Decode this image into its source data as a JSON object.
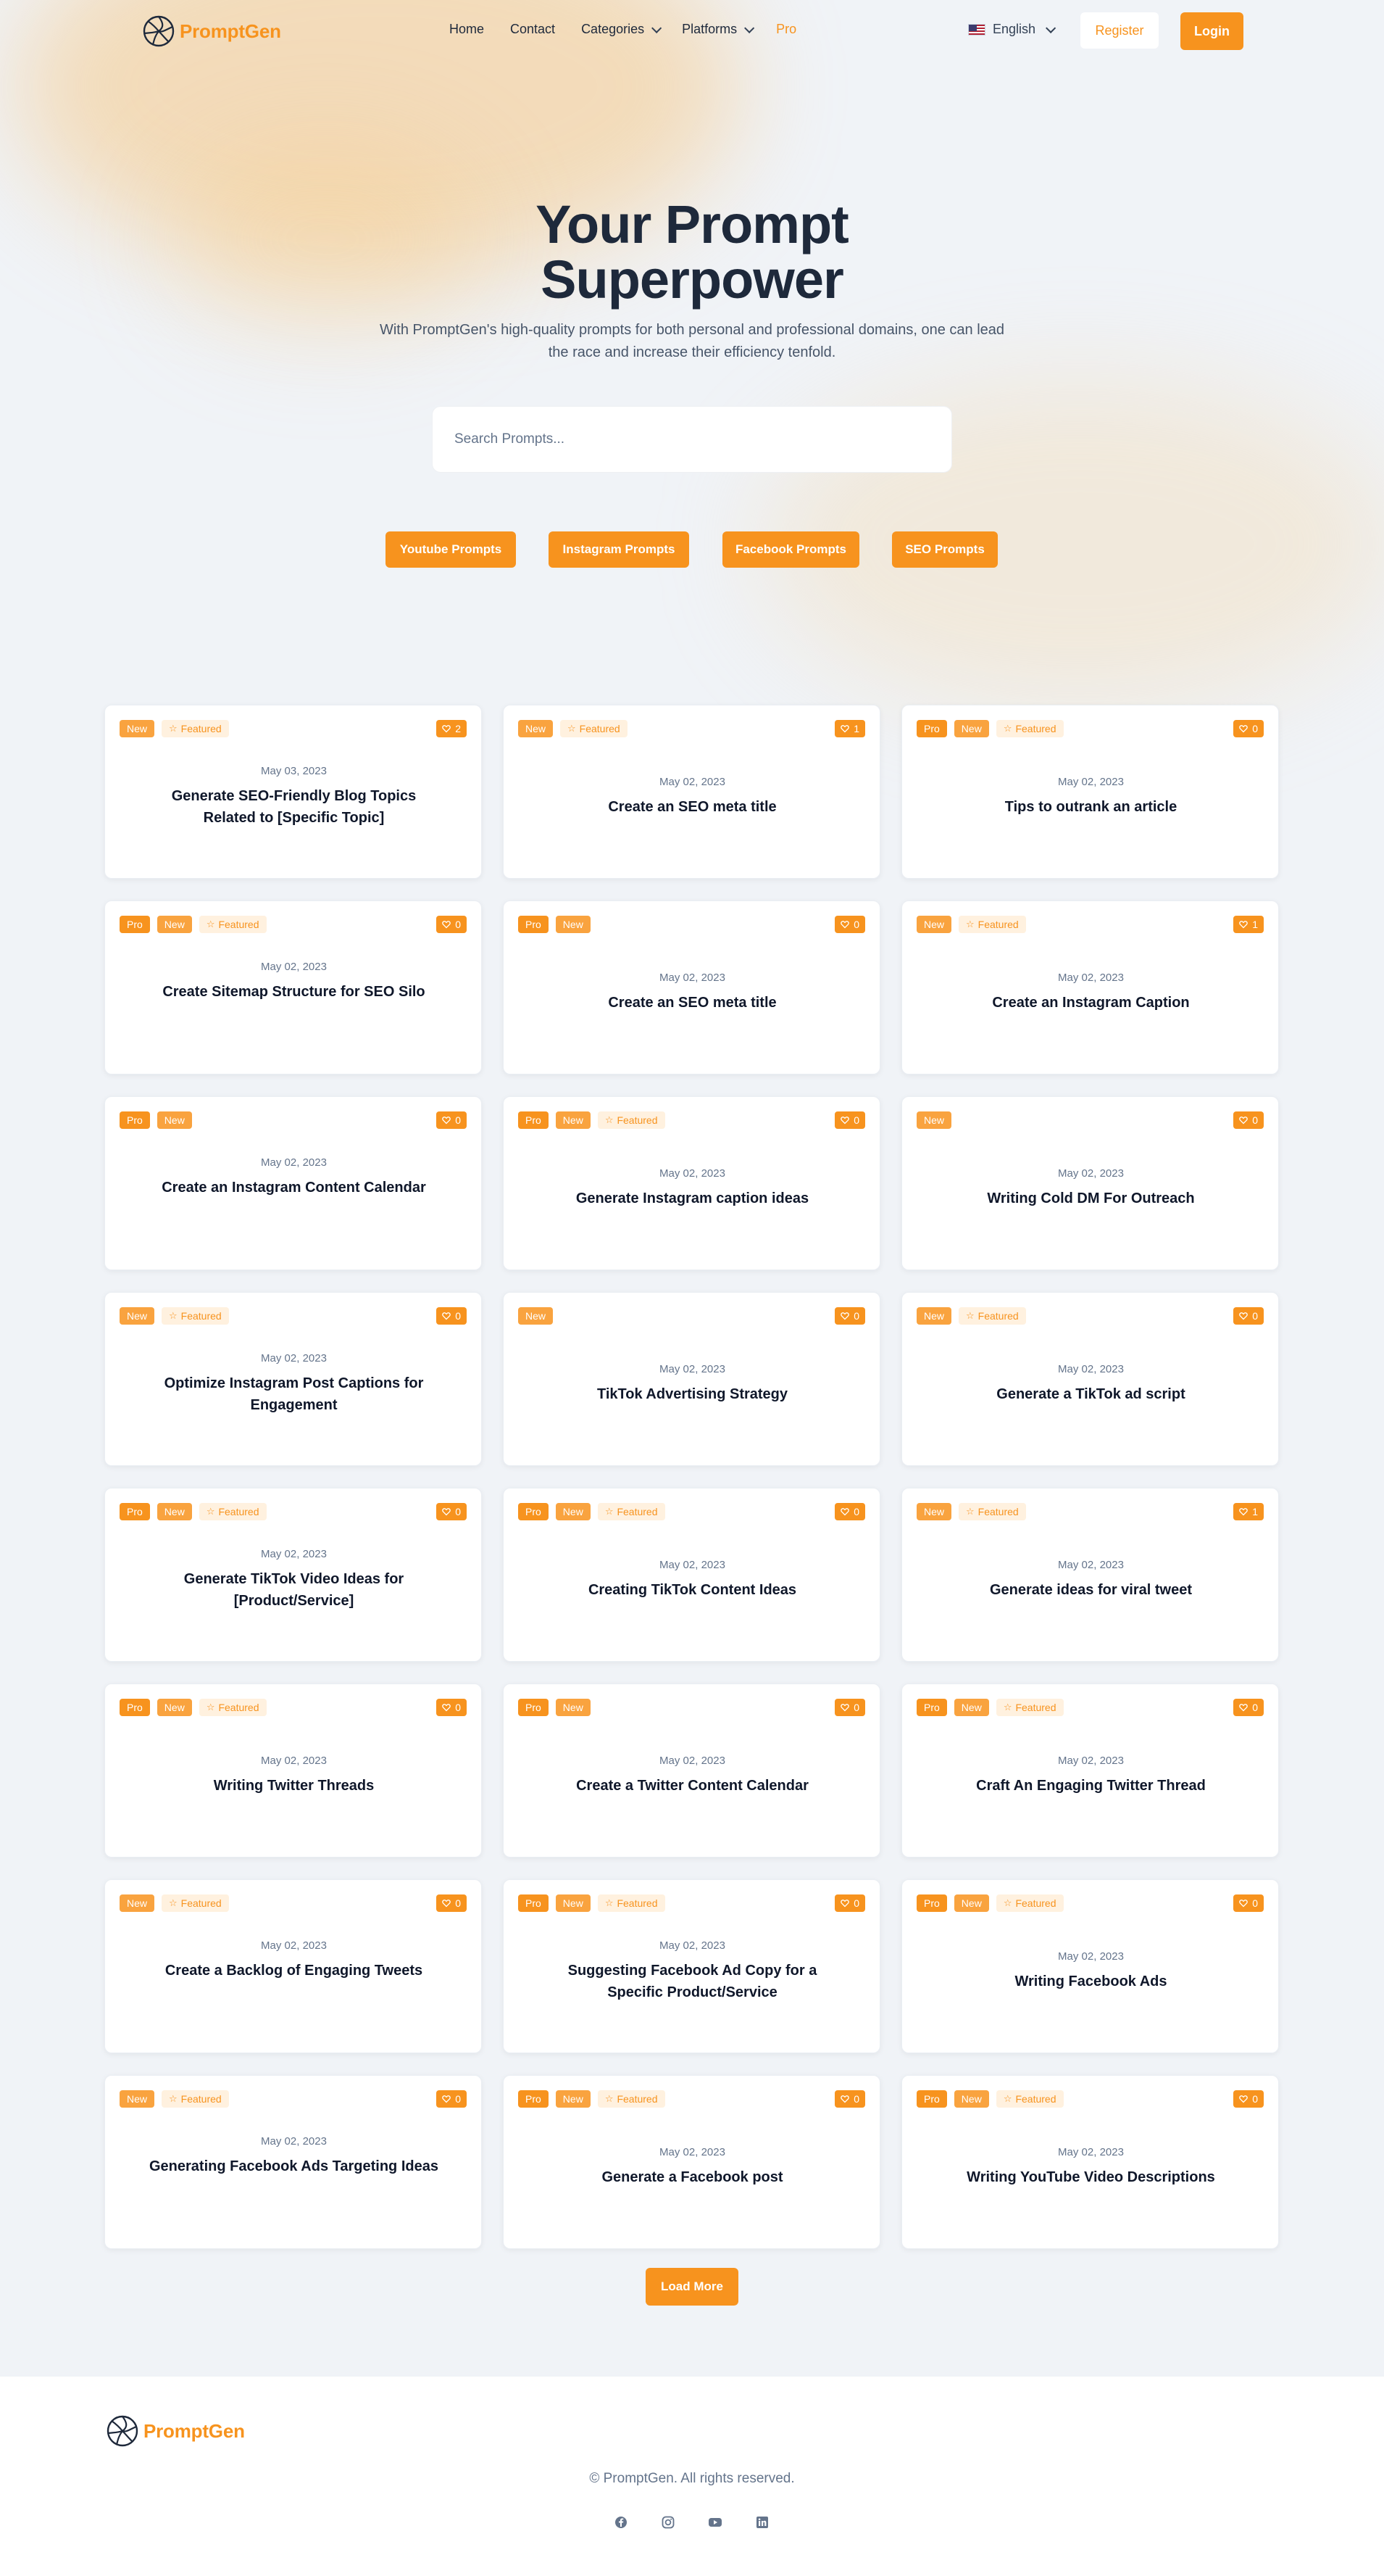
{
  "brand": {
    "name": "PromptGen",
    "accent": "#f7931e"
  },
  "nav": {
    "home": "Home",
    "contact": "Contact",
    "categories": "Categories",
    "platforms": "Platforms",
    "pro": "Pro",
    "language": "English",
    "register": "Register",
    "login": "Login"
  },
  "hero": {
    "title_line1": "Your Prompt",
    "title_line2": "Superpower",
    "subtitle": "With PromptGen's high-quality prompts for both personal and professional domains, one can lead the race and increase their efficiency tenfold.",
    "search_placeholder": "Search Prompts..."
  },
  "categories": [
    "Youtube Prompts",
    "Instagram Prompts",
    "Facebook Prompts",
    "SEO Prompts"
  ],
  "badge_labels": {
    "pro": "Pro",
    "new": "New",
    "featured": "Featured"
  },
  "cards": [
    {
      "pro": false,
      "new": true,
      "featured": true,
      "likes": "2",
      "date": "May 03, 2023",
      "title": "Generate SEO-Friendly Blog Topics Related to [Specific Topic]"
    },
    {
      "pro": false,
      "new": true,
      "featured": true,
      "likes": "1",
      "date": "May 02, 2023",
      "title": "Create an SEO meta title"
    },
    {
      "pro": true,
      "new": true,
      "featured": true,
      "likes": "0",
      "date": "May 02, 2023",
      "title": "Tips to outrank an article"
    },
    {
      "pro": true,
      "new": true,
      "featured": true,
      "likes": "0",
      "date": "May 02, 2023",
      "title": "Create Sitemap Structure for SEO Silo"
    },
    {
      "pro": true,
      "new": true,
      "featured": false,
      "likes": "0",
      "date": "May 02, 2023",
      "title": "Create an SEO meta title"
    },
    {
      "pro": false,
      "new": true,
      "featured": true,
      "likes": "1",
      "date": "May 02, 2023",
      "title": "Create an Instagram Caption"
    },
    {
      "pro": true,
      "new": true,
      "featured": false,
      "likes": "0",
      "date": "May 02, 2023",
      "title": "Create an Instagram Content Calendar"
    },
    {
      "pro": true,
      "new": true,
      "featured": true,
      "likes": "0",
      "date": "May 02, 2023",
      "title": "Generate Instagram caption ideas"
    },
    {
      "pro": false,
      "new": true,
      "featured": false,
      "likes": "0",
      "date": "May 02, 2023",
      "title": "Writing Cold DM For Outreach"
    },
    {
      "pro": false,
      "new": true,
      "featured": true,
      "likes": "0",
      "date": "May 02, 2023",
      "title": "Optimize Instagram Post Captions for Engagement"
    },
    {
      "pro": false,
      "new": true,
      "featured": false,
      "likes": "0",
      "date": "May 02, 2023",
      "title": "TikTok Advertising Strategy"
    },
    {
      "pro": false,
      "new": true,
      "featured": true,
      "likes": "0",
      "date": "May 02, 2023",
      "title": "Generate a TikTok ad script"
    },
    {
      "pro": true,
      "new": true,
      "featured": true,
      "likes": "0",
      "date": "May 02, 2023",
      "title": "Generate TikTok Video Ideas for [Product/Service]"
    },
    {
      "pro": true,
      "new": true,
      "featured": true,
      "likes": "0",
      "date": "May 02, 2023",
      "title": "Creating TikTok Content Ideas"
    },
    {
      "pro": false,
      "new": true,
      "featured": true,
      "likes": "1",
      "date": "May 02, 2023",
      "title": "Generate ideas for viral tweet"
    },
    {
      "pro": true,
      "new": true,
      "featured": true,
      "likes": "0",
      "date": "May 02, 2023",
      "title": "Writing Twitter Threads"
    },
    {
      "pro": true,
      "new": true,
      "featured": false,
      "likes": "0",
      "date": "May 02, 2023",
      "title": "Create a Twitter Content Calendar"
    },
    {
      "pro": true,
      "new": true,
      "featured": true,
      "likes": "0",
      "date": "May 02, 2023",
      "title": "Craft An Engaging Twitter Thread"
    },
    {
      "pro": false,
      "new": true,
      "featured": true,
      "likes": "0",
      "date": "May 02, 2023",
      "title": "Create a Backlog of Engaging Tweets"
    },
    {
      "pro": true,
      "new": true,
      "featured": true,
      "likes": "0",
      "date": "May 02, 2023",
      "title": "Suggesting Facebook Ad Copy for a Specific Product/Service"
    },
    {
      "pro": true,
      "new": true,
      "featured": true,
      "likes": "0",
      "date": "May 02, 2023",
      "title": "Writing Facebook Ads"
    },
    {
      "pro": false,
      "new": true,
      "featured": true,
      "likes": "0",
      "date": "May 02, 2023",
      "title": "Generating Facebook Ads Targeting Ideas"
    },
    {
      "pro": true,
      "new": true,
      "featured": true,
      "likes": "0",
      "date": "May 02, 2023",
      "title": "Generate a Facebook post"
    },
    {
      "pro": true,
      "new": true,
      "featured": true,
      "likes": "0",
      "date": "May 02, 2023",
      "title": "Writing YouTube Video Descriptions"
    }
  ],
  "load_more": "Load More",
  "footer": {
    "copyright": "© PromptGen. All rights reserved.",
    "socials": [
      "facebook-icon",
      "instagram-icon",
      "youtube-icon",
      "linkedin-icon"
    ]
  }
}
